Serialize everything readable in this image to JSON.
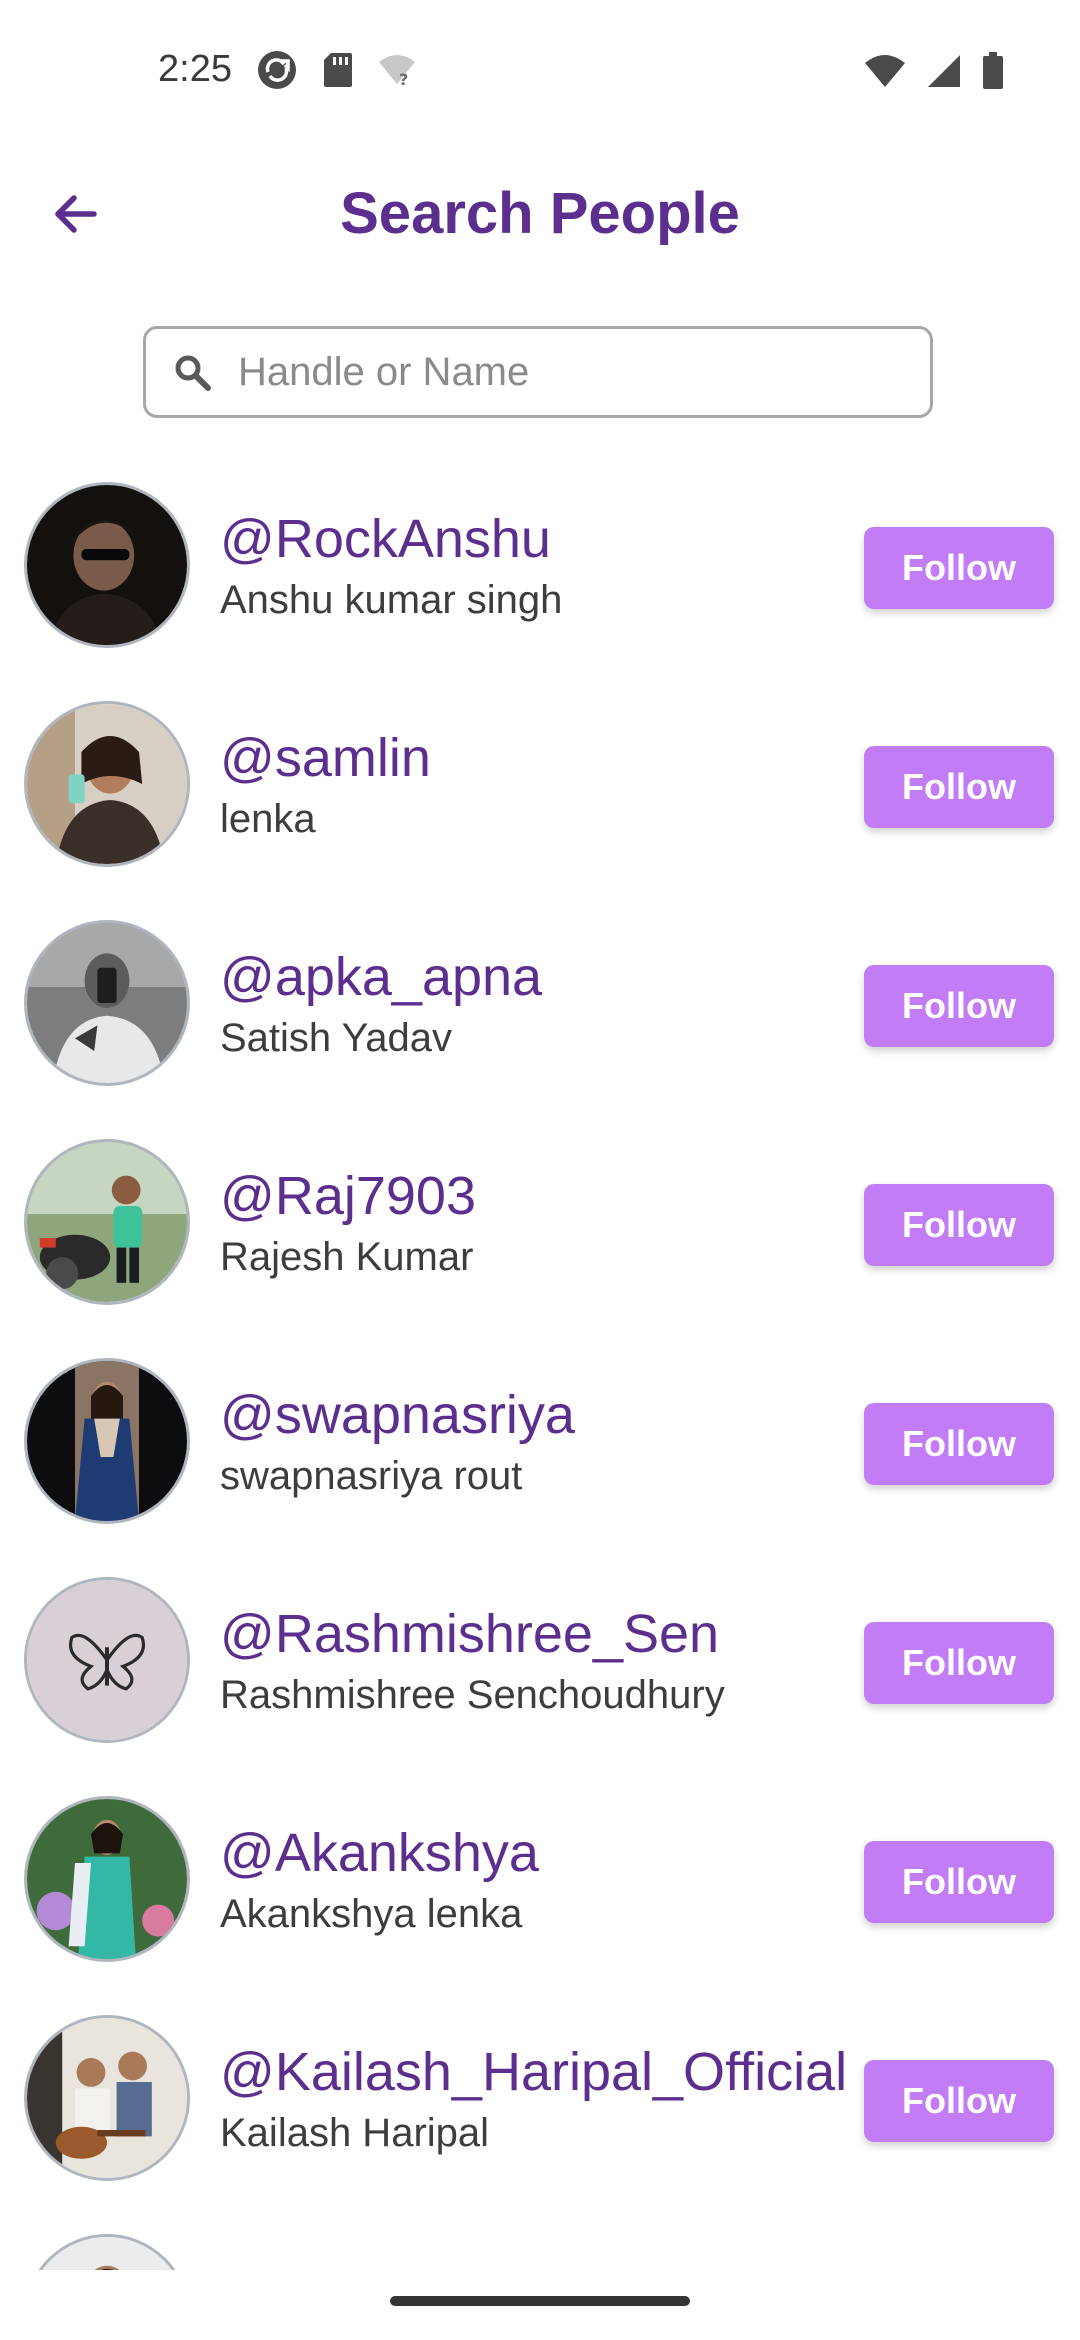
{
  "status_bar": {
    "time": "2:25",
    "icons_left": [
      "sync-icon",
      "sd-card-icon",
      "wifi-question-icon"
    ],
    "icons_right": [
      "wifi-icon",
      "signal-icon",
      "battery-icon"
    ]
  },
  "app_bar": {
    "title": "Search People",
    "back_icon": "arrow-back-icon"
  },
  "search": {
    "placeholder": "Handle or Name",
    "value": ""
  },
  "colors": {
    "accent": "#5c2e8e",
    "follow_button": "#c27cf5"
  },
  "people": [
    {
      "handle": "@RockAnshu",
      "name": "Anshu kumar singh",
      "button": "Follow"
    },
    {
      "handle": "@samlin",
      "name": "lenka",
      "button": "Follow"
    },
    {
      "handle": "@apka_apna",
      "name": "Satish Yadav",
      "button": "Follow"
    },
    {
      "handle": "@Raj7903",
      "name": "Rajesh Kumar",
      "button": "Follow"
    },
    {
      "handle": "@swapnasriya",
      "name": "swapnasriya rout",
      "button": "Follow"
    },
    {
      "handle": "@Rashmishree_Sen",
      "name": "Rashmishree Senchoudhury",
      "button": "Follow"
    },
    {
      "handle": "@Akankshya",
      "name": "Akankshya lenka",
      "button": "Follow"
    },
    {
      "handle": "@Kailash_Haripal_Official",
      "name": "Kailash Haripal",
      "button": "Follow"
    }
  ]
}
